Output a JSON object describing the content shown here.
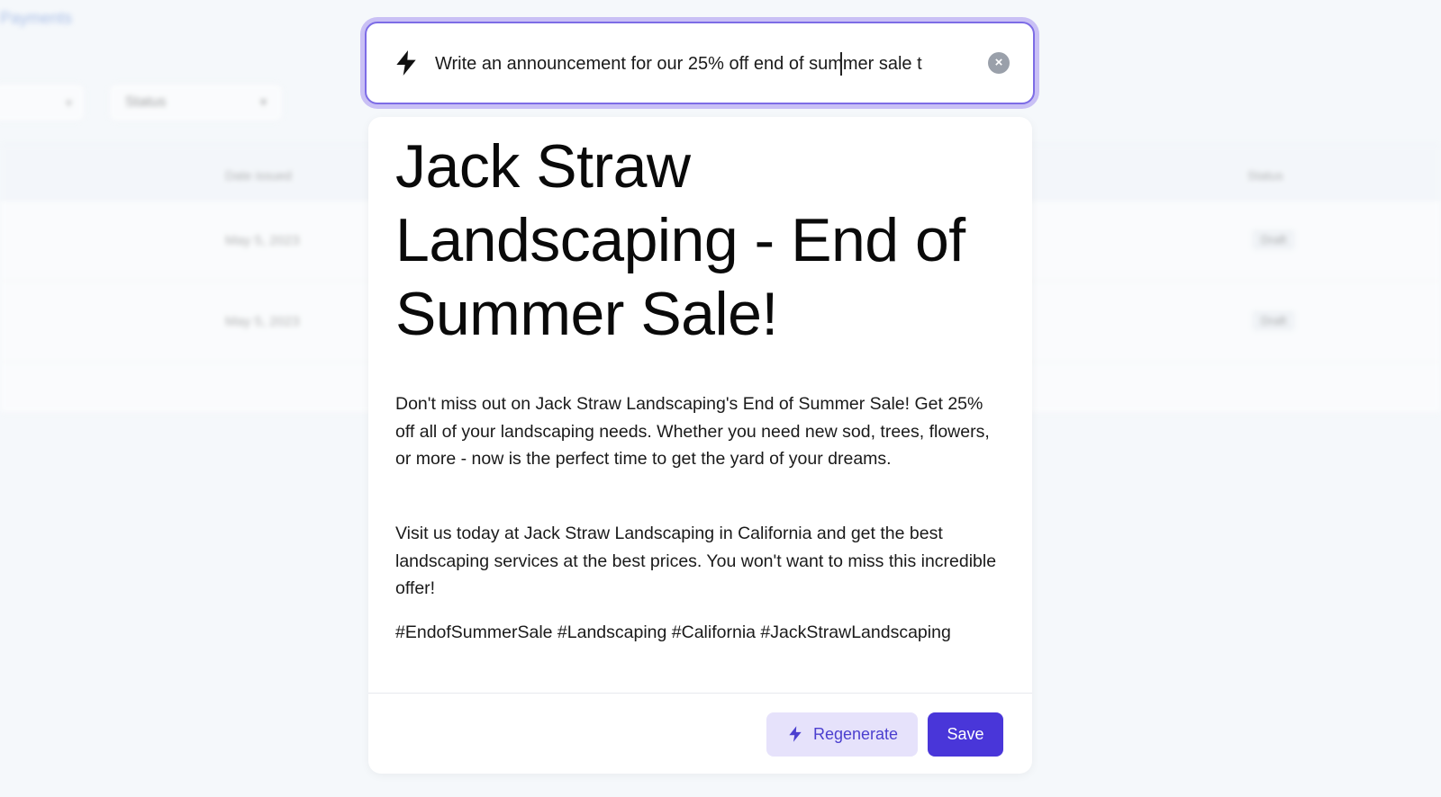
{
  "background": {
    "breadcrumb": "Payments",
    "status_filter_label": "Status",
    "table_headers": {
      "date_issued": "Date issued",
      "status": "Status"
    },
    "rows": [
      {
        "date": "May 5, 2023",
        "status": "Draft"
      },
      {
        "date": "May 5, 2023",
        "status": "Draft"
      }
    ]
  },
  "prompt": {
    "icon": "lightning-bolt-icon",
    "value": "Write an announcement for our 25% off end of summer sale t",
    "clear_icon": "close-circle-icon"
  },
  "result": {
    "title": "Jack Straw Landscaping - End of Summer Sale!",
    "paragraphs": [
      "Don't miss out on Jack Straw Landscaping's End of Summer Sale! Get 25% off all of your landscaping needs. Whether you need new sod, trees, flowers, or more - now is the perfect time to get the yard of your dreams.",
      "Visit us today at Jack Straw Landscaping in California and get the best landscaping services at the best prices. You won't want to miss this incredible offer!",
      "#EndofSummerSale #Landscaping #California #JackStrawLandscaping"
    ],
    "regenerate_label": "Regenerate",
    "save_label": "Save"
  },
  "colors": {
    "accent": "#4936d9",
    "accent_light": "#e6e2fb",
    "focus_ring": "#7d6ce6"
  }
}
